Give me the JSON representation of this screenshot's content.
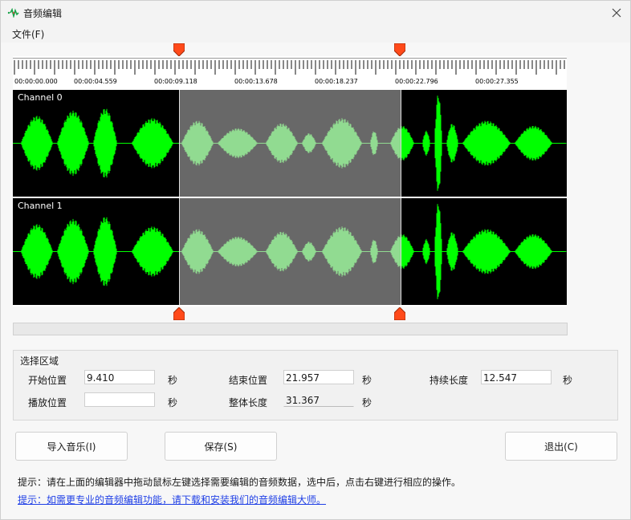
{
  "window": {
    "title": "音频编辑",
    "icon": "app-waveform-icon",
    "close_icon": "close-icon"
  },
  "menu": {
    "file": "文件(F)"
  },
  "ruler": {
    "labels": [
      "00:00:00.000",
      "00:00:04.559",
      "00:00:09.118",
      "00:00:13.678",
      "00:00:18.237",
      "00:00:22.796",
      "00:00:27.355"
    ]
  },
  "channels": [
    {
      "label": "Channel 0"
    },
    {
      "label": "Channel 1"
    }
  ],
  "colors": {
    "waveform": "#00ff00",
    "waveform_selected": "#5cff5c",
    "marker": "#ff4a1a",
    "link": "#1f3fe6"
  },
  "selection_region": {
    "title": "选择区域",
    "start_label": "开始位置",
    "start_value": "9.410",
    "end_label": "结束位置",
    "end_value": "21.957",
    "duration_label": "持续长度",
    "duration_value": "12.547",
    "play_label": "播放位置",
    "play_value": "",
    "total_label": "整体长度",
    "total_value": "31.367",
    "unit": "秒"
  },
  "buttons": {
    "import": "导入音乐(I)",
    "save": "保存(S)",
    "exit": "退出(C)"
  },
  "hint": "提示：请在上面的编辑器中拖动鼠标左键选择需要编辑的音频数据，选中后，点击右键进行相应的操作。",
  "link": "提示：如需更专业的音频编辑功能，请下载和安装我们的音频编辑大师。"
}
